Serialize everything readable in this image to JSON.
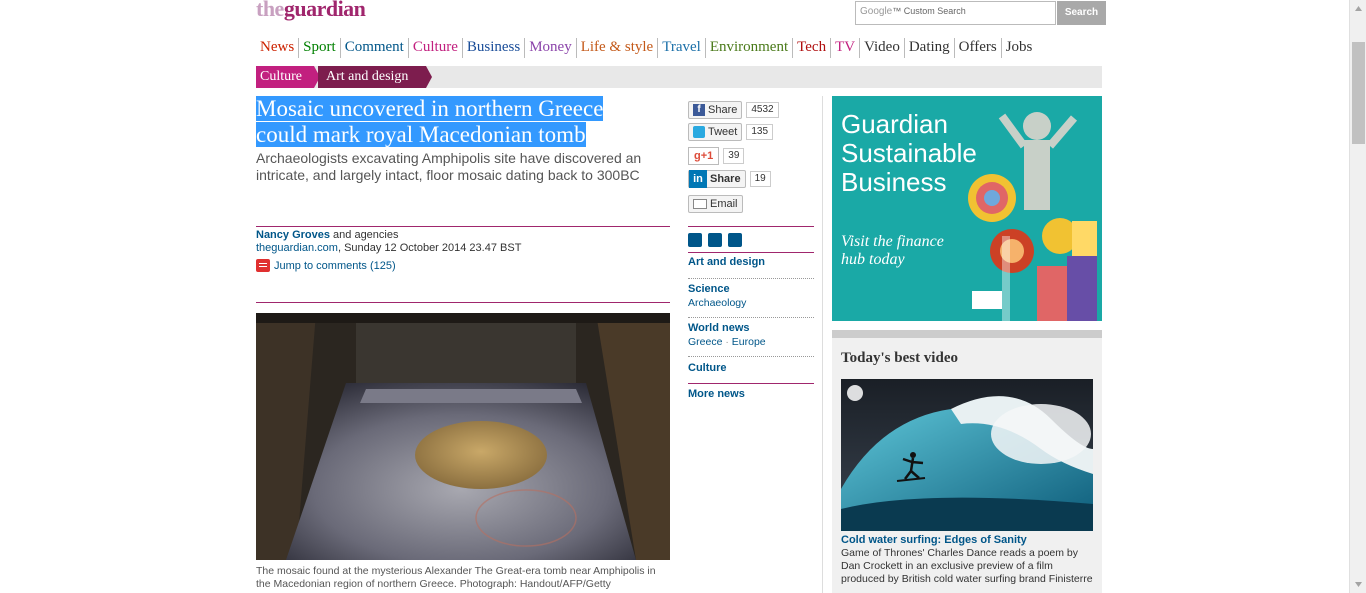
{
  "logo": {
    "the": "the",
    "guardian": "guardian"
  },
  "search": {
    "google_label": "Google",
    "placeholder": "Custom Search",
    "button": "Search"
  },
  "nav": [
    {
      "label": "News",
      "color": "#cc2200"
    },
    {
      "label": "Sport",
      "color": "#008000"
    },
    {
      "label": "Comment",
      "color": "#005689"
    },
    {
      "label": "Culture",
      "color": "#c2207f"
    },
    {
      "label": "Business",
      "color": "#1a4d99"
    },
    {
      "label": "Money",
      "color": "#8b44aa"
    },
    {
      "label": "Life & style",
      "color": "#c45a1a"
    },
    {
      "label": "Travel",
      "color": "#1a6fa8"
    },
    {
      "label": "Environment",
      "color": "#4a7a1a"
    },
    {
      "label": "Tech",
      "color": "#b01010"
    },
    {
      "label": "TV",
      "color": "#c2207f"
    },
    {
      "label": "Video",
      "color": "#333333"
    },
    {
      "label": "Dating",
      "color": "#333333"
    },
    {
      "label": "Offers",
      "color": "#333333"
    },
    {
      "label": "Jobs",
      "color": "#333333"
    }
  ],
  "breadcrumb": {
    "section": "Culture",
    "subsection": "Art and design"
  },
  "article": {
    "headline_line1": "Mosaic uncovered in northern Greece",
    "headline_line2": "could mark royal Macedonian tomb",
    "standfirst": "Archaeologists excavating Amphipolis site have discovered an intricate, and largely intact, floor mosaic dating back to 300BC",
    "author": "Nancy Groves",
    "author_suffix": " and agencies",
    "site": "theguardian.com",
    "date": ", Sunday 12 October 2014 23.47 BST",
    "jump_comments": "Jump to comments (125)",
    "caption": "The mosaic found at the mysterious Alexander The Great-era tomb near Amphipolis in the Macedonian region of northern Greece. Photograph: Handout/AFP/Getty"
  },
  "share": {
    "facebook": {
      "label": "Share",
      "count": "4532",
      "icon": "f"
    },
    "twitter": {
      "label": "Tweet",
      "count": "135"
    },
    "gplus": {
      "label": "g+1",
      "count": "39"
    },
    "linkedin": {
      "label": "Share",
      "count": "19",
      "icon": "in"
    },
    "email": {
      "label": "Email"
    }
  },
  "related": {
    "art": "Art and design",
    "science": "Science",
    "archaeology": "Archaeology",
    "world": "World news",
    "greece": "Greece",
    "sep": " · ",
    "europe": "Europe",
    "culture": "Culture",
    "more": "More news"
  },
  "ad": {
    "title1": "Guardian",
    "title2": "Sustainable",
    "title3": "Business",
    "cta": "Visit the finance hub today"
  },
  "video": {
    "heading": "Today's best video",
    "title": "Cold water surfing: Edges of Sanity",
    "description": "Game of Thrones' Charles Dance reads a poem by Dan Crockett in an exclusive preview of a film produced by British cold water surfing brand Finisterre"
  }
}
